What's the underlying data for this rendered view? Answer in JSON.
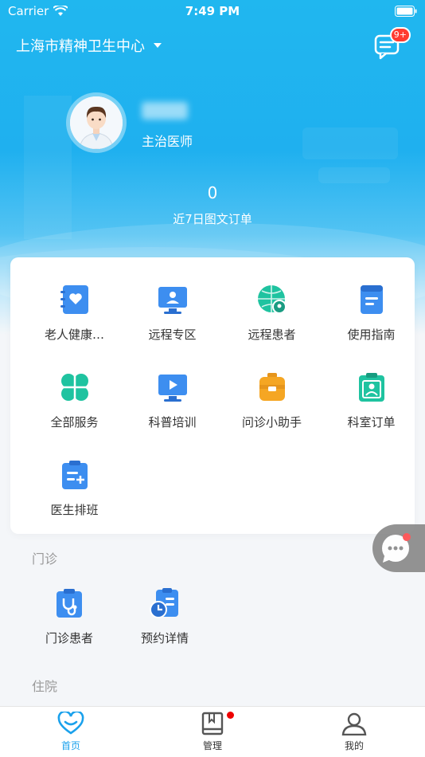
{
  "status_bar": {
    "carrier": "Carrier",
    "time": "7:49 PM"
  },
  "header": {
    "hospital": "上海市精神卫生中心",
    "message_badge": "9+"
  },
  "profile": {
    "role": "主治医师"
  },
  "orders": {
    "count": "0",
    "label": "近7日图文订单"
  },
  "services": [
    {
      "label": "老人健康…",
      "icon": "elder-health-icon"
    },
    {
      "label": "远程专区",
      "icon": "remote-zone-icon"
    },
    {
      "label": "远程患者",
      "icon": "remote-patient-icon"
    },
    {
      "label": "使用指南",
      "icon": "guide-icon"
    },
    {
      "label": "全部服务",
      "icon": "all-services-icon"
    },
    {
      "label": "科普培训",
      "icon": "training-video-icon"
    },
    {
      "label": "问诊小助手",
      "icon": "assistant-icon"
    },
    {
      "label": "科室订单",
      "icon": "department-order-icon"
    },
    {
      "label": "医生排班",
      "icon": "schedule-icon"
    }
  ],
  "outpatient": {
    "title": "门诊",
    "items": [
      {
        "label": "门诊患者",
        "icon": "outpatient-icon"
      },
      {
        "label": "预约详情",
        "icon": "appointment-icon"
      }
    ]
  },
  "inpatient": {
    "title": "住院"
  },
  "tabs": [
    {
      "label": "首页",
      "icon": "home-heart-icon"
    },
    {
      "label": "管理",
      "icon": "book-icon"
    },
    {
      "label": "我的",
      "icon": "person-icon"
    }
  ],
  "colors": {
    "primary": "#1aa1ec",
    "hero": "#1fb0ef",
    "badge": "#ff3b30"
  }
}
